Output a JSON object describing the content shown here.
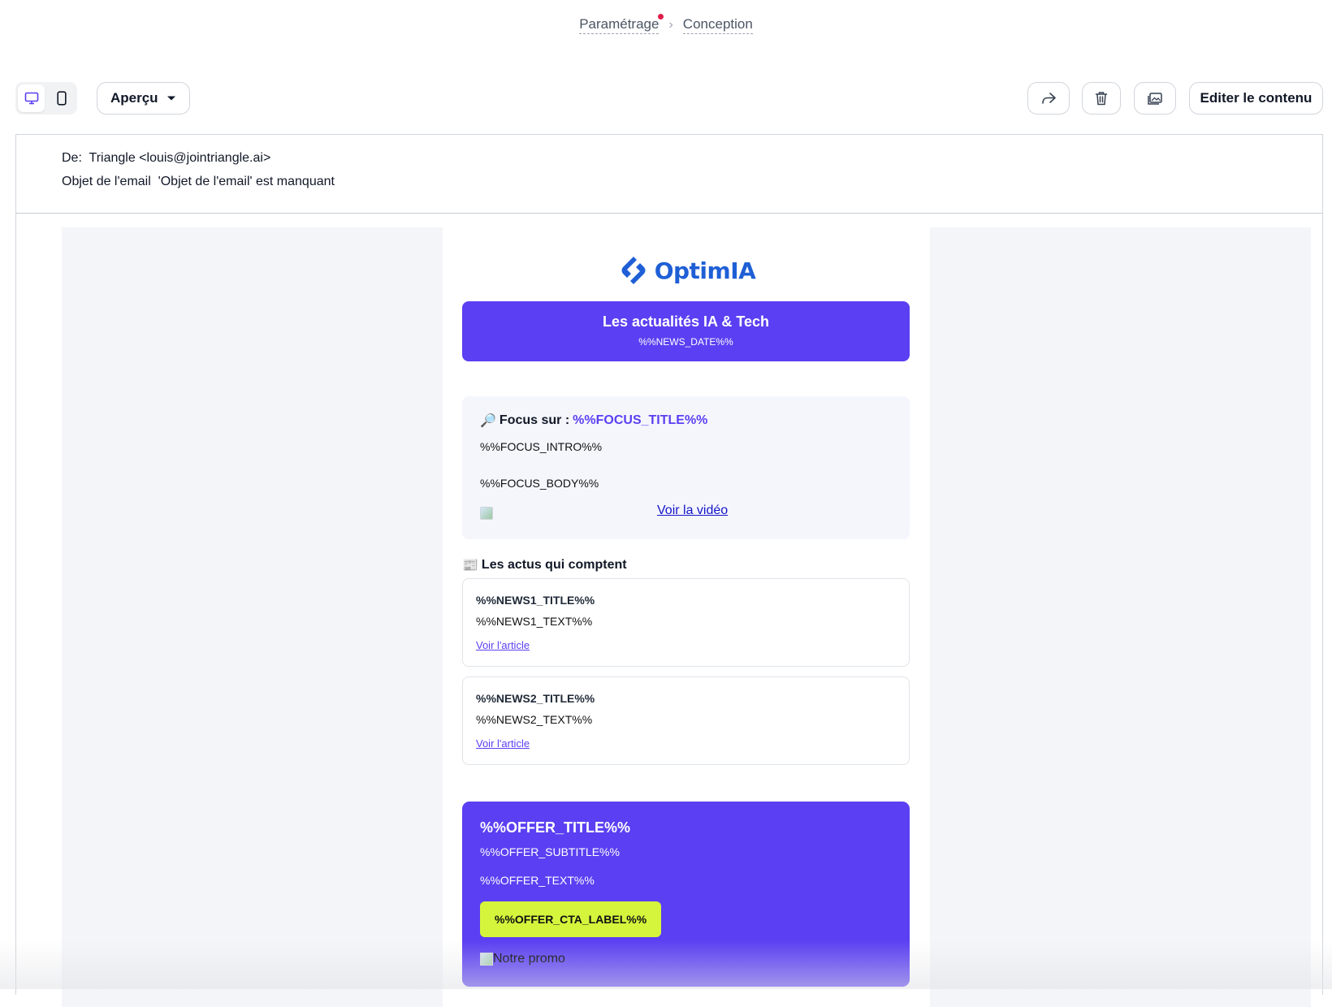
{
  "breadcrumb": {
    "items": [
      {
        "label": "Paramétrage"
      },
      {
        "label": "Conception"
      }
    ]
  },
  "toolbar": {
    "device_icons": [
      "desktop-icon",
      "mobile-icon"
    ],
    "view_select": "Aperçu",
    "action_icons": [
      "share-icon",
      "trash-icon",
      "images-icon"
    ],
    "edit_label": "Editer le contenu"
  },
  "meta": {
    "from_label": "De:",
    "from_value": "Triangle <louis@jointriangle.ai>",
    "subject_label": "Objet de l'email",
    "subject_value": "'Objet de l'email' est manquant"
  },
  "email": {
    "logo_text": "OptimIA",
    "hero": {
      "title": "Les actualités IA & Tech",
      "date": "%%NEWS_DATE%%"
    },
    "focus": {
      "emoji": "🔎",
      "label": "Focus sur :",
      "title": "%%FOCUS_TITLE%%",
      "intro": "%%FOCUS_INTRO%%",
      "body": "%%FOCUS_BODY%%",
      "video_link": "Voir la vidéo"
    },
    "actus": {
      "emoji": "📰",
      "title": "Les actus qui comptent",
      "items": [
        {
          "title": "%%NEWS1_TITLE%%",
          "text": "%%NEWS1_TEXT%%",
          "link": "Voir l'article"
        },
        {
          "title": "%%NEWS2_TITLE%%",
          "text": "%%NEWS2_TEXT%%",
          "link": "Voir l'article"
        }
      ]
    },
    "offer": {
      "title": "%%OFFER_TITLE%%",
      "subtitle": "%%OFFER_SUBTITLE%%",
      "text": "%%OFFER_TEXT%%",
      "cta": "%%OFFER_CTA_LABEL%%",
      "image_alt": "Notre promo"
    }
  },
  "colors": {
    "brand": "#5b3ff2",
    "logo": "#1f5fd6",
    "cta": "#d4f53c",
    "notification_dot": "#e11d48"
  }
}
